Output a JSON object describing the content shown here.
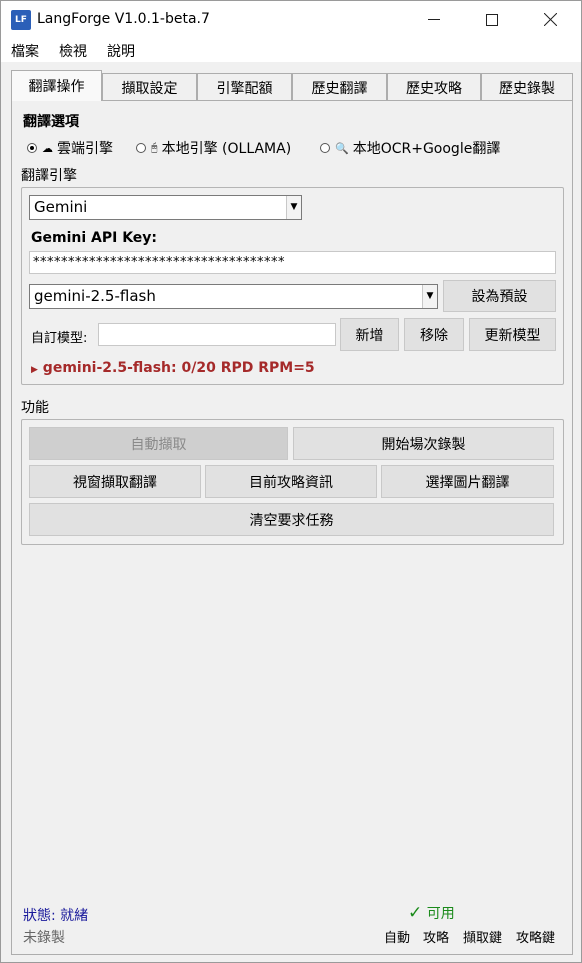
{
  "window": {
    "title": "LangForge  V1.0.1-beta.7",
    "icon_text": "LF",
    "controls": {
      "minimize_icon": "minimize-icon",
      "maximize_icon": "maximize-icon",
      "close_icon": "close-icon"
    }
  },
  "menu": [
    "檔案",
    "檢視",
    "說明"
  ],
  "tabs": [
    "翻譯操作",
    "擷取設定",
    "引擎配額",
    "歷史翻譯",
    "歷史攻略",
    "歷史錄製"
  ],
  "active_tab": "翻譯操作",
  "translate_options": {
    "title": "翻譯選項",
    "radios": [
      {
        "label": "雲端引擎",
        "icon": "cloud-icon",
        "selected": true
      },
      {
        "label": "本地引擎 (OLLAMA)",
        "icon": "local-icon",
        "selected": false
      },
      {
        "label": "本地OCR+Google翻譯",
        "icon": "magnifier-icon",
        "selected": false
      }
    ]
  },
  "engine": {
    "title": "翻譯引擎",
    "provider": "Gemini",
    "api_key_label": "Gemini API Key:",
    "api_key_value": "************************************",
    "model": "gemini-2.5-flash",
    "set_default": "設為預設",
    "custom_model_label": "自訂模型:",
    "custom_model_value": "",
    "add": "新增",
    "remove": "移除",
    "update_models": "更新模型",
    "quota": "gemini-2.5-flash:  0/20 RPD  RPM=5"
  },
  "functions": {
    "title": "功能",
    "auto_capture": "自動擷取",
    "start_record": "開始場次錄製",
    "window_capture": "視窗擷取翻譯",
    "guide_info": "目前攻略資訊",
    "image_translate": "選擇圖片翻譯",
    "clear_tasks": "清空要求任務"
  },
  "status": {
    "state": "狀態: 就緒",
    "record": "未錄製",
    "available": "可用",
    "available_color": "#1a8a1a",
    "shortcuts": [
      "自動",
      "攻略",
      "擷取鍵",
      "攻略鍵"
    ]
  }
}
